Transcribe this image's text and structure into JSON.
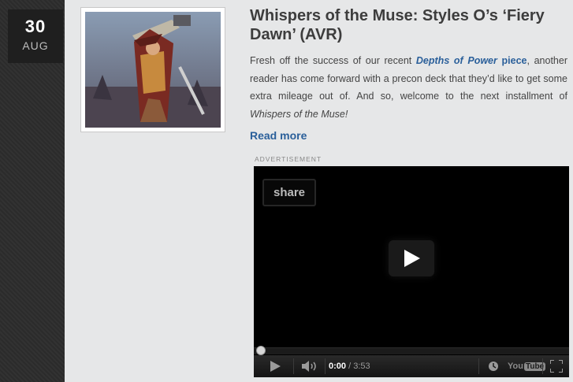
{
  "date": {
    "day": "30",
    "month": "AUG"
  },
  "post": {
    "title": "Whispers of the Muse: Styles O’s ‘Fiery Dawn’ (AVR)",
    "excerpt_before": "Fresh off the success of our recent ",
    "link_italic": "Depths of Power",
    "link_plain": " piece",
    "excerpt_middle": ", another reader has come forward with a precon deck that they’d like to get some extra mileage out of. And so, welcome to the next installment of ",
    "excerpt_italic": "Whispers of the Muse!",
    "read_more": "Read more"
  },
  "ad": {
    "label": "ADVERTISEMENT",
    "share_label": "share",
    "time_current": "0:00",
    "time_separator": " / ",
    "time_total": "3:53",
    "logo_you": "You",
    "logo_tube": "Tube",
    "progress": 0
  }
}
